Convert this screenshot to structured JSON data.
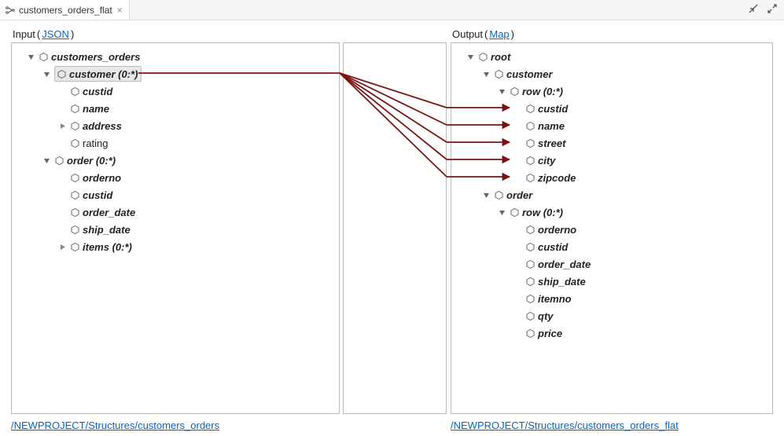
{
  "tab": {
    "title": "customers_orders_flat"
  },
  "input": {
    "label": "Input",
    "format_link": "JSON",
    "path_link": "/NEWPROJECT/Structures/customers_orders",
    "tree": {
      "root": "customers_orders",
      "customer": "customer (0:*)",
      "custid": "custid",
      "name": "name",
      "address": "address",
      "rating": "rating",
      "order": "order (0:*)",
      "orderno": "orderno",
      "order_custid": "custid",
      "order_date": "order_date",
      "ship_date": "ship_date",
      "items": "items (0:*)"
    }
  },
  "output": {
    "label": "Output",
    "format_link": "Map",
    "path_link": "/NEWPROJECT/Structures/customers_orders_flat",
    "tree": {
      "root": "root",
      "customer": "customer",
      "cust_row": "row (0:*)",
      "custid": "custid",
      "name": "name",
      "street": "street",
      "city": "city",
      "zipcode": "zipcode",
      "order": "order",
      "order_row": "row (0:*)",
      "orderno": "orderno",
      "order_custid": "custid",
      "order_date": "order_date",
      "ship_date": "ship_date",
      "itemno": "itemno",
      "qty": "qty",
      "price": "price"
    }
  }
}
